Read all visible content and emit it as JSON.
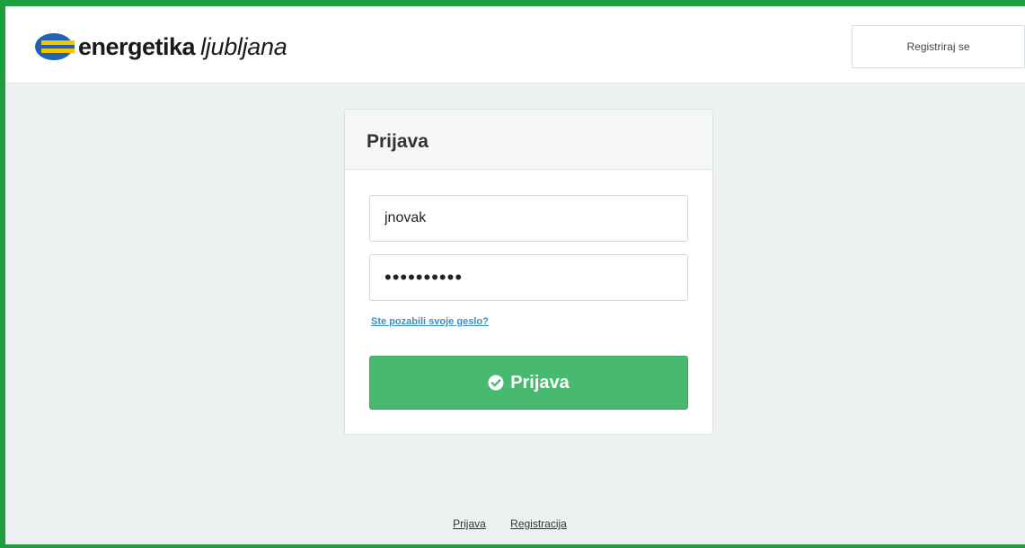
{
  "brand": {
    "name_bold": "energetika",
    "name_italic": "ljubljana",
    "logo_icon": "energetika-logo-icon",
    "colors": {
      "blue": "#1f63b4",
      "yellow": "#f5c400",
      "accent_green": "#1e9e3e"
    }
  },
  "header": {
    "register_label": "Registriraj se"
  },
  "login": {
    "title": "Prijava",
    "username_value": "jnovak",
    "password_value": "••••••••••",
    "forgot_label": "Ste pozabili svoje geslo?",
    "submit_label": "Prijava",
    "submit_icon": "check-circle-icon",
    "submit_color": "#47ba6f"
  },
  "footer": {
    "links": [
      "Prijava",
      "Registracija"
    ]
  }
}
